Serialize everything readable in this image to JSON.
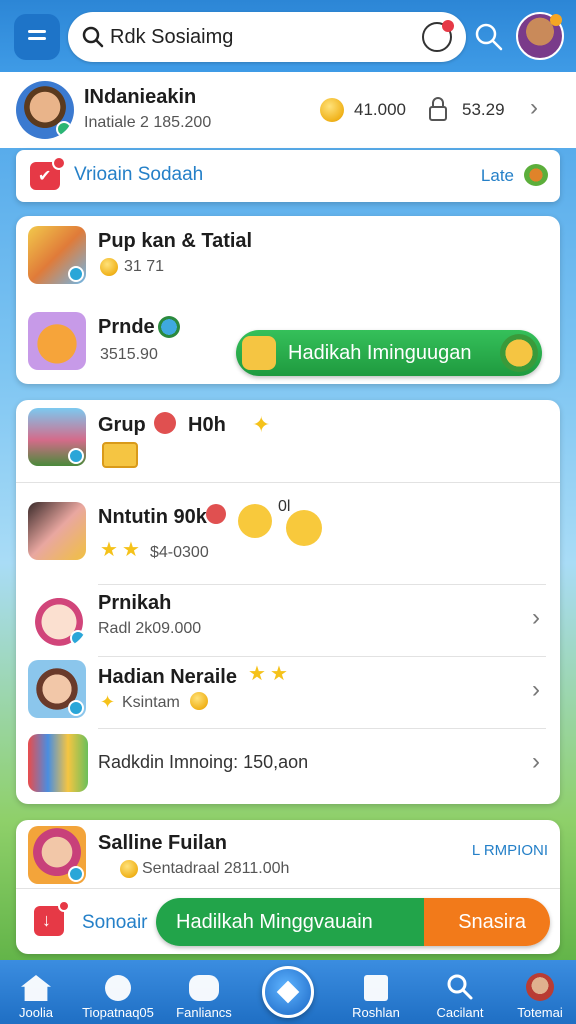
{
  "search": {
    "value": "Rdk Sosiaimg"
  },
  "profile": {
    "name": "INdanieakin",
    "subtitle": "Inatiale 2 185.200",
    "coins": "41.000",
    "locked": "53.29"
  },
  "banner": {
    "label": "Vrioain Sodaah",
    "action": "Late"
  },
  "section1": {
    "items": [
      {
        "title": "Pup kan & Tatial",
        "sub": "31 71"
      },
      {
        "title": "Prnde",
        "sub": "3515.90"
      }
    ],
    "cta": "Hadikah Iminguugan"
  },
  "section2": {
    "group_title": "Grup",
    "group_suffix": "H0h",
    "items": [
      {
        "title": "Nntutin 90k",
        "sub": "$4-0300",
        "extra": "0l"
      },
      {
        "title": "Prnikah",
        "sub": "Radl 2k09.000"
      },
      {
        "title": "Hadian Neraile",
        "sub": "Ksintam"
      },
      {
        "title": "Radkdin Imnoing: 150,aon",
        "sub": ""
      }
    ]
  },
  "section3": {
    "title": "Salline Fuilan",
    "sub": "Sentadraal 2811.00h",
    "tag": "L RMPIONI",
    "left_label": "Sonoair",
    "cta": "Hadilkah Minggvauain",
    "cta_right": "Snasira"
  },
  "nav": [
    {
      "label": "Joolia"
    },
    {
      "label": "Tiopatnaq05"
    },
    {
      "label": "Fanliancs"
    },
    {
      "label": ""
    },
    {
      "label": "Roshlan"
    },
    {
      "label": "Cacilant"
    },
    {
      "label": "Totemai"
    }
  ],
  "colors": {
    "accent_blue": "#2f8fe0",
    "green": "#27a84a",
    "orange": "#f27a1a",
    "red": "#e63946"
  }
}
